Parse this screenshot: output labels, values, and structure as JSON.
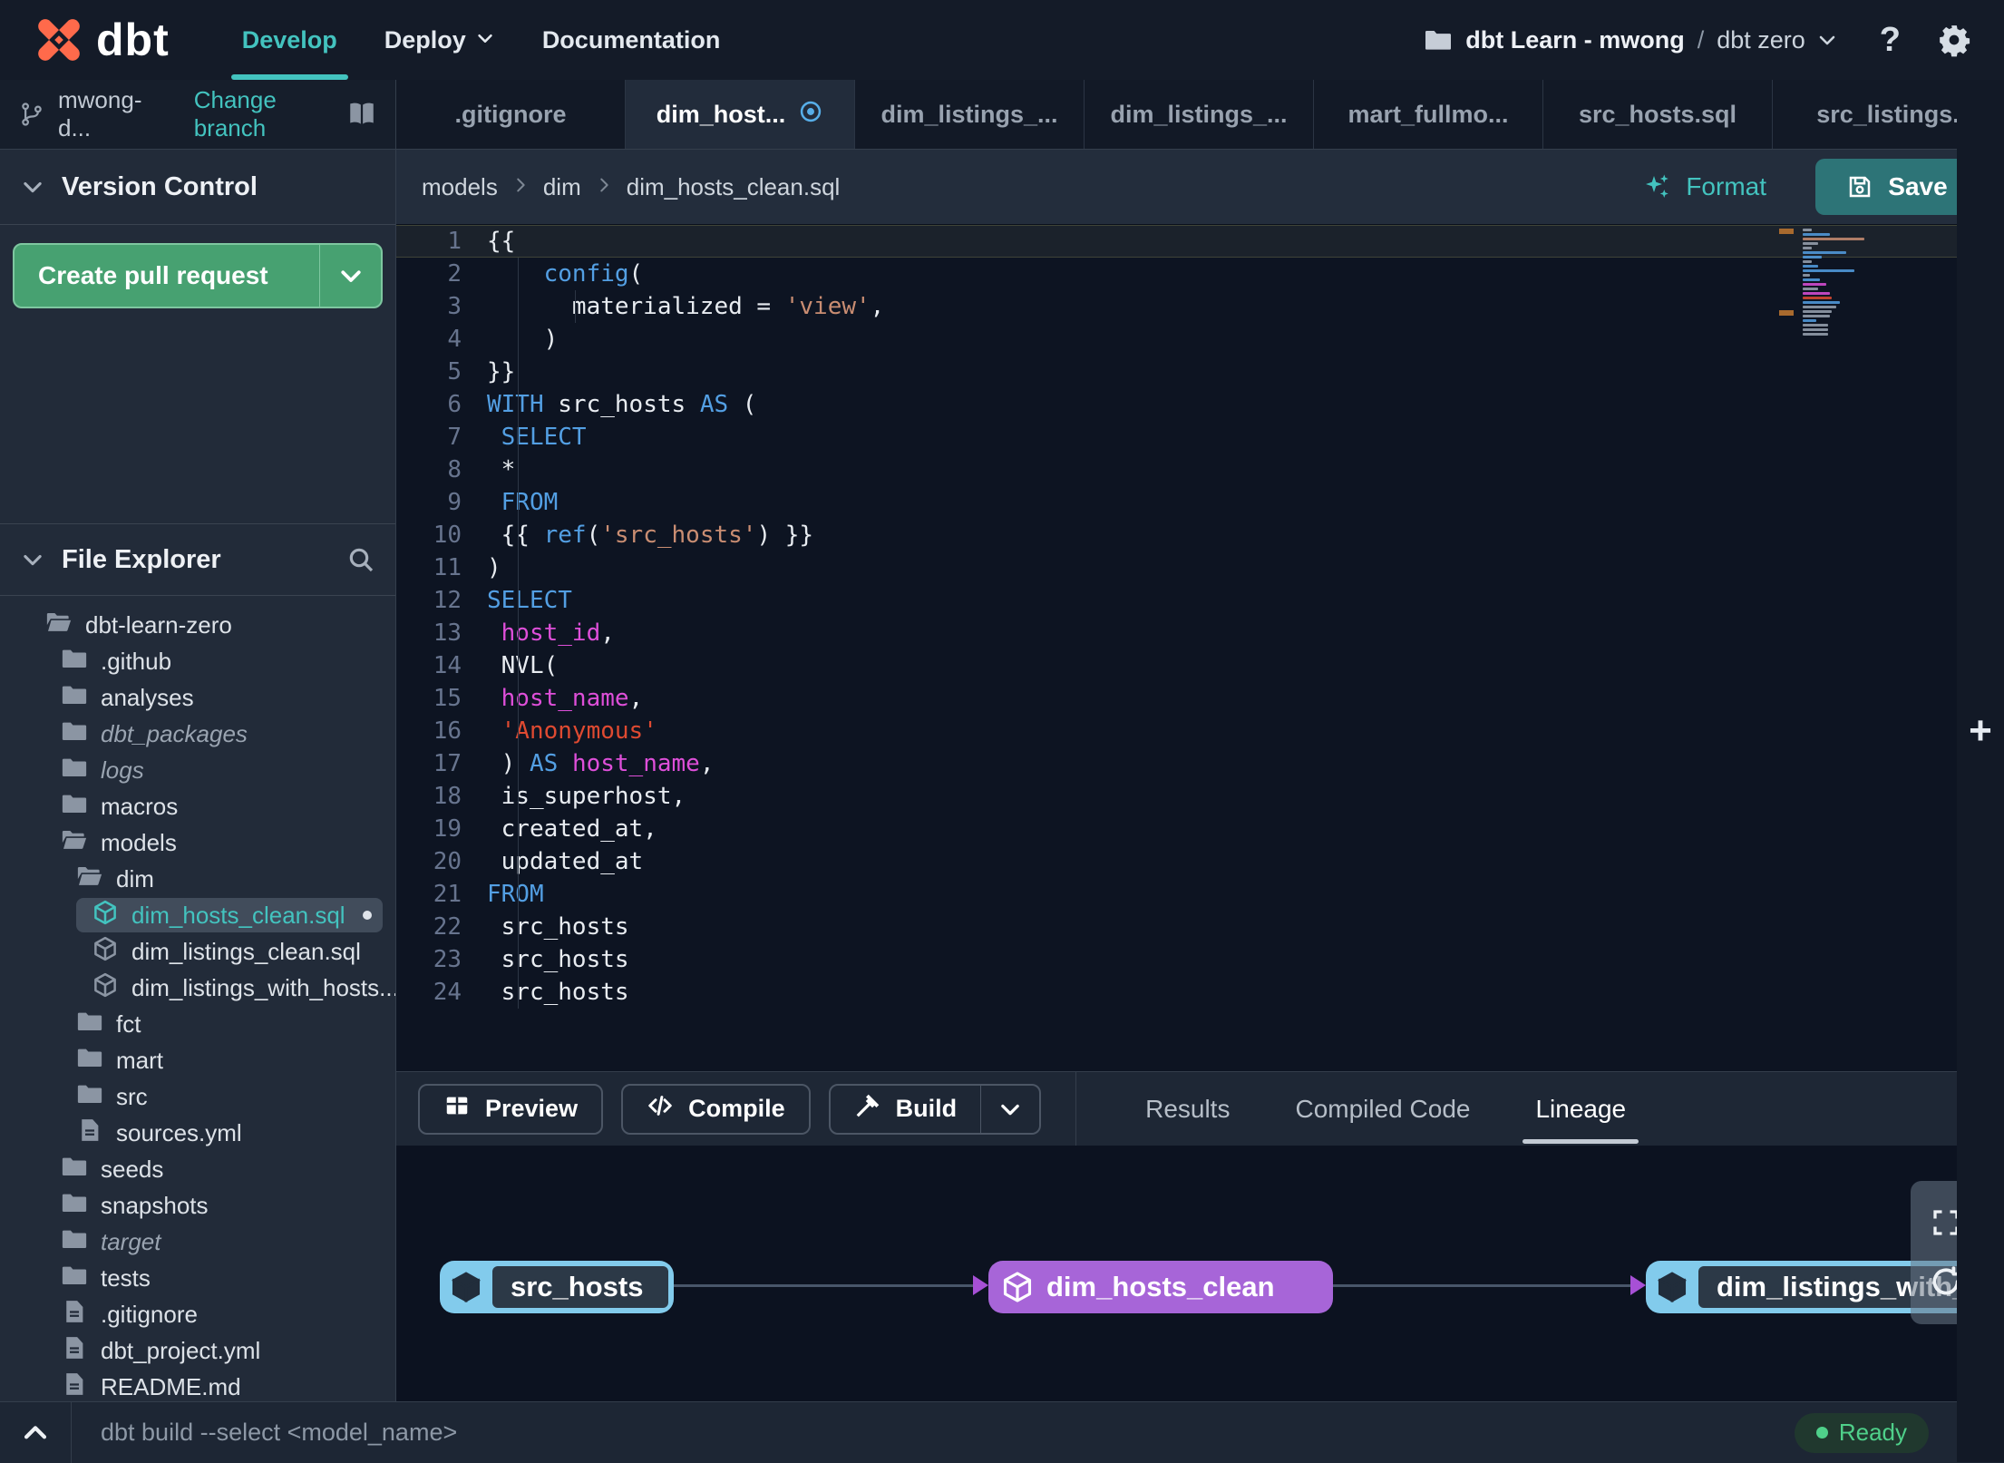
{
  "colors": {
    "accent": "#43c3bf",
    "green_button": "#47a171",
    "save_button": "#2d7477",
    "node_blue": "#82cbec",
    "node_purple": "#a765d8",
    "ready_green": "#4fd08a",
    "keyword_blue": "#539fe3",
    "string_tan": "#c98d72",
    "string_red": "#df4a31",
    "ident_magenta": "#de4fd9",
    "logo_orange": "#ff6a4b"
  },
  "header": {
    "logo_text": "dbt",
    "nav": [
      {
        "label": "Develop",
        "active": true,
        "chevron": false
      },
      {
        "label": "Deploy",
        "active": false,
        "chevron": true
      },
      {
        "label": "Documentation",
        "active": false,
        "chevron": false
      }
    ],
    "project": {
      "name": "dbt Learn - mwong",
      "sep": "/",
      "env": "dbt zero"
    },
    "help_label": "?"
  },
  "branchbar": {
    "branch": "mwong-d...",
    "change": "Change branch"
  },
  "tabsbar": {
    "tabs": [
      {
        "label": ".gitignore"
      },
      {
        "label": "dim_host...",
        "active": true,
        "dot": true
      },
      {
        "label": "dim_listings_..."
      },
      {
        "label": "dim_listings_..."
      },
      {
        "label": "mart_fullmo..."
      },
      {
        "label": "src_hosts.sql"
      },
      {
        "label": "src_listings.",
        "shrink": true
      }
    ],
    "new_tab_label": "+"
  },
  "sidebar": {
    "version_control": {
      "title": "Version Control",
      "create_pr": "Create pull request"
    },
    "file_explorer": {
      "title": "File Explorer"
    },
    "tree": [
      {
        "label": "dbt-learn-zero",
        "depth": 0,
        "icon": "folder-open"
      },
      {
        "label": ".github",
        "depth": 1,
        "icon": "folder"
      },
      {
        "label": "analyses",
        "depth": 1,
        "icon": "folder"
      },
      {
        "label": "dbt_packages",
        "depth": 1,
        "icon": "folder",
        "italic": true
      },
      {
        "label": "logs",
        "depth": 1,
        "icon": "folder",
        "italic": true
      },
      {
        "label": "macros",
        "depth": 1,
        "icon": "folder"
      },
      {
        "label": "models",
        "depth": 1,
        "icon": "folder-open"
      },
      {
        "label": "dim",
        "depth": 2,
        "icon": "folder-open"
      },
      {
        "label": "dim_hosts_clean.sql",
        "depth": 3,
        "icon": "model",
        "selected": true,
        "modified": true
      },
      {
        "label": "dim_listings_clean.sql",
        "depth": 3,
        "icon": "model"
      },
      {
        "label": "dim_listings_with_hosts...",
        "depth": 3,
        "icon": "model"
      },
      {
        "label": "fct",
        "depth": 2,
        "icon": "folder"
      },
      {
        "label": "mart",
        "depth": 2,
        "icon": "folder"
      },
      {
        "label": "src",
        "depth": 2,
        "icon": "folder"
      },
      {
        "label": "sources.yml",
        "depth": 2,
        "icon": "file"
      },
      {
        "label": "seeds",
        "depth": 1,
        "icon": "folder"
      },
      {
        "label": "snapshots",
        "depth": 1,
        "icon": "folder"
      },
      {
        "label": "target",
        "depth": 1,
        "icon": "folder",
        "italic": true
      },
      {
        "label": "tests",
        "depth": 1,
        "icon": "folder"
      },
      {
        "label": ".gitignore",
        "depth": 1,
        "icon": "file"
      },
      {
        "label": "dbt_project.yml",
        "depth": 1,
        "icon": "file"
      },
      {
        "label": "README.md",
        "depth": 1,
        "icon": "file"
      }
    ]
  },
  "breadcrumb": [
    "models",
    "dim",
    "dim_hosts_clean.sql"
  ],
  "editor_actions": {
    "format": "Format",
    "save": "Save"
  },
  "code": {
    "lines": [
      {
        "n": 1,
        "cur": true,
        "s": [
          [
            "pl",
            "{{"
          ]
        ]
      },
      {
        "n": 2,
        "s": [
          [
            "pl",
            "    "
          ],
          [
            "kw",
            "config"
          ],
          [
            "pl",
            "("
          ]
        ]
      },
      {
        "n": 3,
        "s": [
          [
            "pl",
            "      materialized = "
          ],
          [
            "str",
            "'view'"
          ],
          [
            "pl",
            ","
          ]
        ]
      },
      {
        "n": 4,
        "s": [
          [
            "pl",
            "    )"
          ]
        ]
      },
      {
        "n": 5,
        "s": [
          [
            "pl",
            "}}"
          ]
        ]
      },
      {
        "n": 6,
        "s": [
          [
            "kw",
            "WITH"
          ],
          [
            "pl",
            " src_hosts "
          ],
          [
            "kw",
            "AS"
          ],
          [
            "pl",
            " ("
          ]
        ]
      },
      {
        "n": 7,
        "s": [
          [
            "pl",
            " "
          ],
          [
            "kw",
            "SELECT"
          ]
        ]
      },
      {
        "n": 8,
        "s": [
          [
            "pl",
            " *"
          ]
        ]
      },
      {
        "n": 9,
        "s": [
          [
            "pl",
            " "
          ],
          [
            "kw",
            "FROM"
          ]
        ]
      },
      {
        "n": 10,
        "s": [
          [
            "pl",
            " {{ "
          ],
          [
            "kw",
            "ref"
          ],
          [
            "pl",
            "("
          ],
          [
            "str",
            "'src_hosts'"
          ],
          [
            "pl",
            ") }}"
          ]
        ]
      },
      {
        "n": 11,
        "s": [
          [
            "pl",
            ")"
          ]
        ]
      },
      {
        "n": 12,
        "s": [
          [
            "kw",
            "SELECT"
          ]
        ]
      },
      {
        "n": 13,
        "s": [
          [
            "pl",
            " "
          ],
          [
            "mg",
            "host_id"
          ],
          [
            "pl",
            ","
          ]
        ]
      },
      {
        "n": 14,
        "s": [
          [
            "pl",
            " NVL("
          ]
        ]
      },
      {
        "n": 15,
        "s": [
          [
            "pl",
            " "
          ],
          [
            "mg",
            "host_name"
          ],
          [
            "pl",
            ","
          ]
        ]
      },
      {
        "n": 16,
        "s": [
          [
            "pl",
            " "
          ],
          [
            "red",
            "'Anonymous'"
          ]
        ]
      },
      {
        "n": 17,
        "s": [
          [
            "pl",
            " ) "
          ],
          [
            "kw",
            "AS"
          ],
          [
            "pl",
            " "
          ],
          [
            "mg",
            "host_name"
          ],
          [
            "pl",
            ","
          ]
        ]
      },
      {
        "n": 18,
        "s": [
          [
            "pl",
            " is_superhost,"
          ]
        ]
      },
      {
        "n": 19,
        "s": [
          [
            "pl",
            " created_at,"
          ]
        ]
      },
      {
        "n": 20,
        "s": [
          [
            "pl",
            " updated_at"
          ]
        ]
      },
      {
        "n": 21,
        "s": [
          [
            "kw",
            "FROM"
          ]
        ]
      },
      {
        "n": 22,
        "s": [
          [
            "pl",
            " src_hosts"
          ]
        ]
      },
      {
        "n": 23,
        "s": [
          [
            "pl",
            " src_hosts"
          ]
        ]
      },
      {
        "n": 24,
        "s": [
          [
            "pl",
            " src_hosts"
          ]
        ]
      }
    ]
  },
  "panel": {
    "buttons": [
      {
        "label": "Preview",
        "icon": "grid"
      },
      {
        "label": "Compile",
        "icon": "code"
      },
      {
        "label": "Build",
        "icon": "hammer",
        "split": true
      }
    ],
    "tabs": [
      {
        "label": "Results"
      },
      {
        "label": "Compiled Code"
      },
      {
        "label": "Lineage",
        "active": true
      }
    ]
  },
  "lineage": {
    "nodes": [
      {
        "label": "src_hosts",
        "style": "blue"
      },
      {
        "label": "dim_hosts_clean",
        "style": "purple"
      },
      {
        "label": "dim_listings_with_h",
        "style": "blue"
      }
    ]
  },
  "command_bar": {
    "placeholder": "dbt build --select <model_name>",
    "status": "Ready"
  }
}
